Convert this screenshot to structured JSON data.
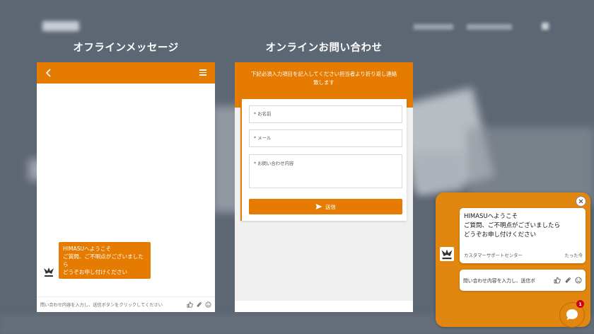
{
  "titles": {
    "offline": "オフラインメッセージ",
    "online": "オンラインお問い合わせ"
  },
  "offline_panel": {
    "bot_message": [
      "HIMASUへようこそ",
      "ご質問、ご不明点がございましたら",
      "どうぞお申し付けください"
    ],
    "input_placeholder": "問い合わせ内容を入力し、送信ボタンをクリックしてください"
  },
  "online_panel": {
    "header_line1": "下記必須入力項目を記入してください担当者より折り返し連絡",
    "header_line2": "致します",
    "name_placeholder": "* お名前",
    "email_placeholder": "* メール",
    "message_placeholder": "* お問い合わせ内容",
    "send_label": "送信"
  },
  "widget": {
    "message": [
      "HIMASUへようこそ",
      "ご質問、ご不明点がございましたら",
      "どうぞお申し付けください"
    ],
    "sender": "カスタマーサポートセンター",
    "time": "たった今",
    "input_placeholder": "問い合わせ内容を入力し、送信ボ",
    "badge_count": "1"
  },
  "icons": {
    "back": "chevron-left-icon",
    "menu": "hamburger-menu-icon",
    "thumbs_up": "thumbs-up-icon",
    "attach": "paperclip-icon",
    "emoji": "smiley-icon",
    "send": "paper-plane-icon",
    "close": "close-icon",
    "chat": "chat-bubble-icon"
  },
  "colors": {
    "brand_orange": "#e57b00",
    "widget_orange": "#e1870f",
    "background": "#5d6673",
    "badge_red": "#d0021b"
  }
}
